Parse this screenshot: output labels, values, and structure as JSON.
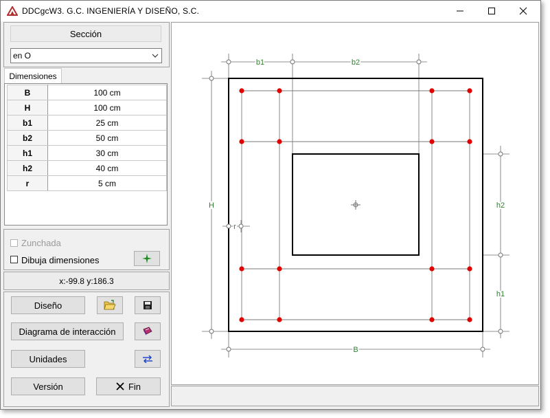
{
  "window": {
    "title": "DDCgcW3. G.C. INGENIERÍA Y DISEÑO, S.C."
  },
  "left": {
    "section_label": "Sección",
    "section_select": {
      "value": "en O"
    },
    "dims_tab": "Dimensiones",
    "dimensions": [
      {
        "key": "B",
        "value": "100 cm"
      },
      {
        "key": "H",
        "value": "100 cm"
      },
      {
        "key": "b1",
        "value": "25 cm"
      },
      {
        "key": "b2",
        "value": "50 cm"
      },
      {
        "key": "h1",
        "value": "30 cm"
      },
      {
        "key": "h2",
        "value": "40 cm"
      },
      {
        "key": "r",
        "value": "5 cm"
      }
    ],
    "zunchada": {
      "label": "Zunchada",
      "checked": false,
      "enabled": false
    },
    "dibuja": {
      "label": "Dibuja dimensiones",
      "checked": false
    },
    "coords": "x:-99.8 y:186.3",
    "buttons": {
      "diseno": "Diseño",
      "diagrama": "Diagrama de interacción",
      "unidades": "Unidades",
      "version": "Versión",
      "fin": "Fin"
    }
  },
  "drawing": {
    "labels": {
      "b1": "b1",
      "b2": "b2",
      "H": "H",
      "r": "r",
      "h2": "h2",
      "h1": "h1",
      "B": "B"
    },
    "colors": {
      "dim": "#2f7f2f",
      "rebar": "#e00000",
      "outline": "#000000",
      "grid": "#6d6d6d"
    }
  },
  "icons": {
    "app": "app-logo-icon",
    "open": "open-folder-icon",
    "save": "save-disk-icon",
    "book": "book-icon",
    "units": "convert-arrows-icon",
    "pick": "crosshair-star-icon",
    "fin": "close-x-icon"
  }
}
